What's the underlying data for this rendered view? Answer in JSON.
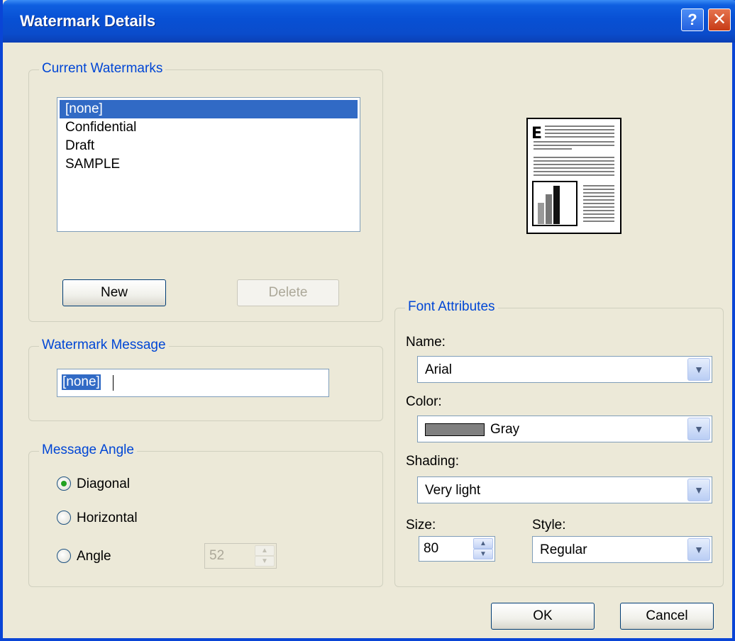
{
  "window": {
    "title": "Watermark Details"
  },
  "titlebar": {
    "help_label": "?",
    "close_label": "✕"
  },
  "current_watermarks": {
    "legend": "Current Watermarks",
    "items": [
      "[none]",
      "Confidential",
      "Draft",
      "SAMPLE"
    ],
    "selected": "[none]",
    "new_label": "New",
    "delete_label": "Delete"
  },
  "watermark_message": {
    "legend": "Watermark Message",
    "value": "[none]"
  },
  "message_angle": {
    "legend": "Message Angle",
    "options": [
      "Diagonal",
      "Horizontal",
      "Angle"
    ],
    "selected": "Diagonal",
    "angle_value": "52"
  },
  "font_attributes": {
    "legend": "Font Attributes",
    "name_label": "Name:",
    "name_value": "Arial",
    "color_label": "Color:",
    "color_value": "Gray",
    "color_swatch": "#808080",
    "shading_label": "Shading:",
    "shading_value": "Very light",
    "size_label": "Size:",
    "size_value": "80",
    "style_label": "Style:",
    "style_value": "Regular"
  },
  "footer": {
    "ok_label": "OK",
    "cancel_label": "Cancel"
  },
  "colors": {
    "title_bar": "#0a4ccb",
    "dialog_bg": "#ece9d8",
    "legend_text": "#0046d5",
    "selection": "#316ac5"
  },
  "icons": {
    "help": "question-mark",
    "close": "x-mark",
    "preview": "page-preview",
    "dropdown": "chevron-down",
    "spin": "up-down-arrows"
  }
}
